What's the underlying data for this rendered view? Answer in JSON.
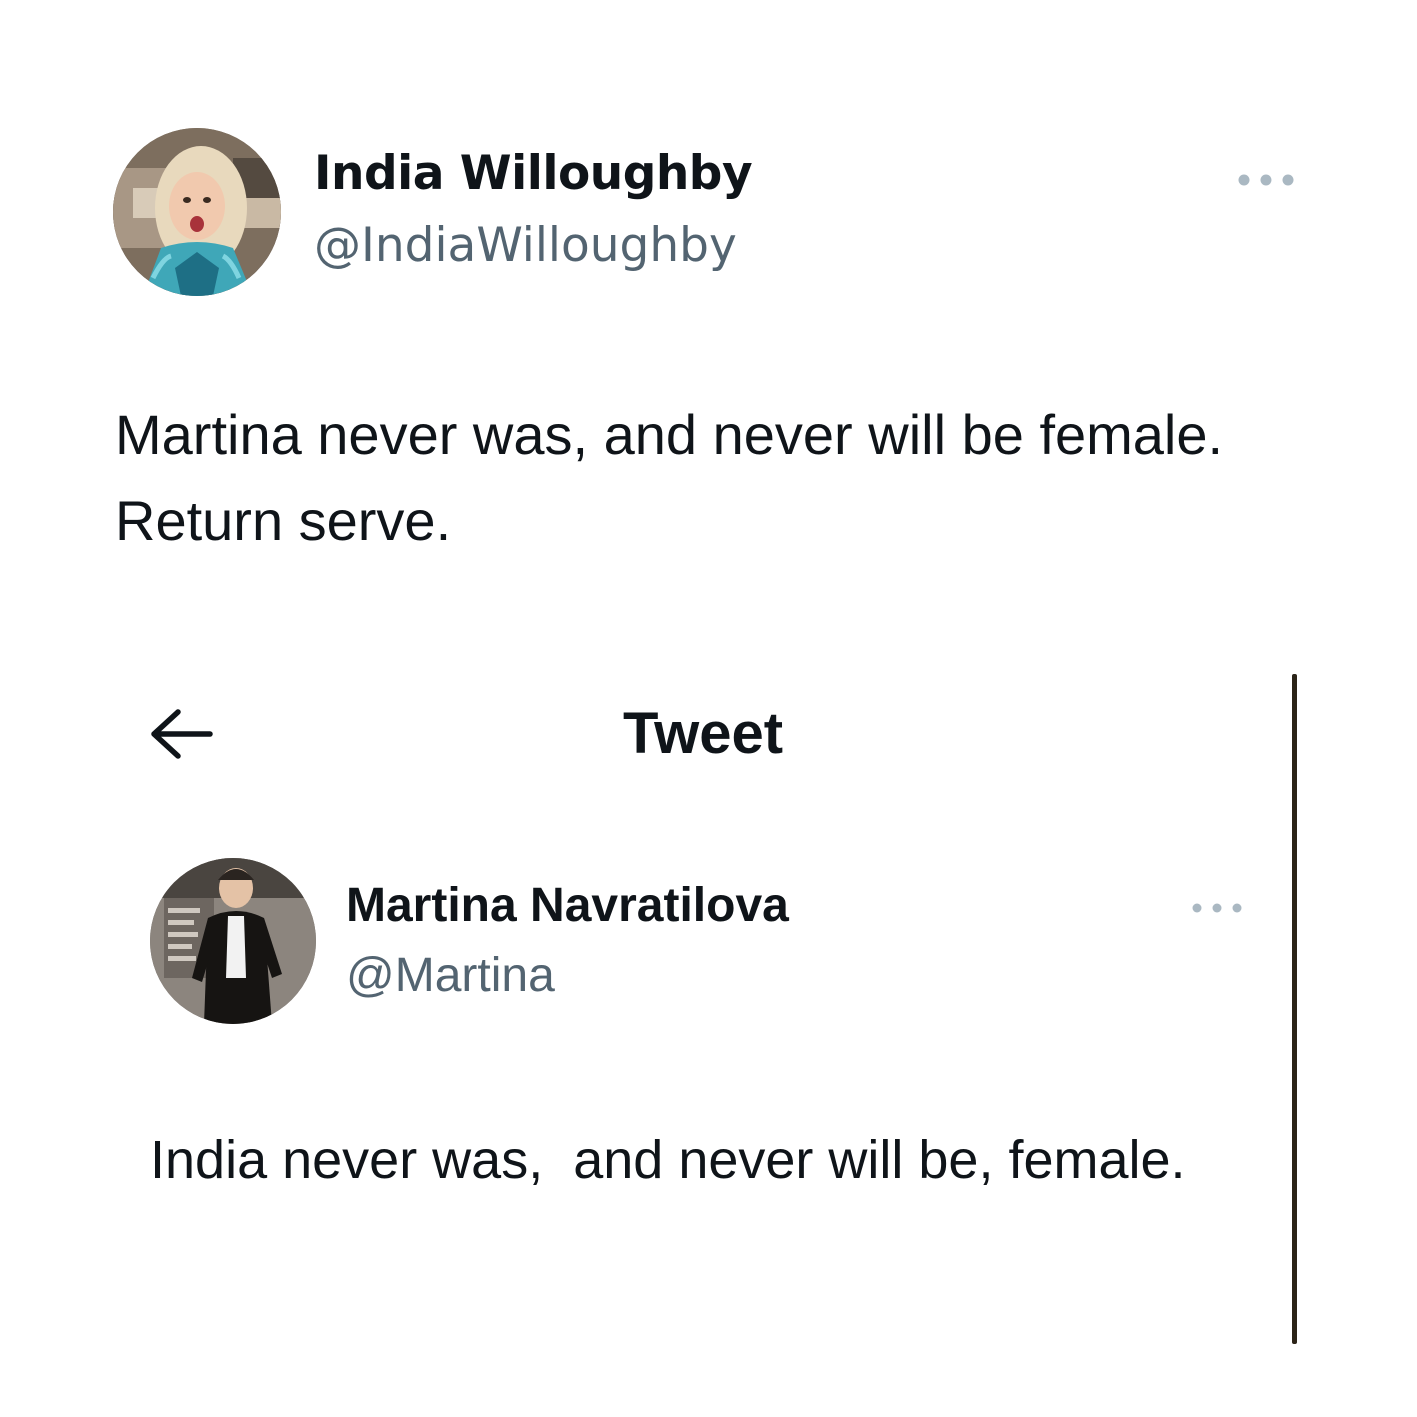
{
  "outer_tweet": {
    "display_name": "India Willoughby",
    "handle": "@IndiaWilloughby",
    "text": "Martina never was, and never will be female. Return serve.",
    "more_icon": "more-horizontal-icon",
    "avatar": "profile-photo-india-willoughby"
  },
  "embedded_screenshot": {
    "header_title": "Tweet",
    "back_icon": "arrow-left-icon",
    "tweet": {
      "display_name": "Martina Navratilova",
      "handle": "@Martina",
      "text": "India never was,  and never will be, female.",
      "more_icon": "more-horizontal-icon",
      "avatar": "profile-photo-martina-navratilova"
    }
  },
  "colors": {
    "primary_text": "#0f1419",
    "secondary_text": "#536471",
    "more_dots": "#aab8c2",
    "divider": "#2c2418",
    "background": "#ffffff"
  }
}
